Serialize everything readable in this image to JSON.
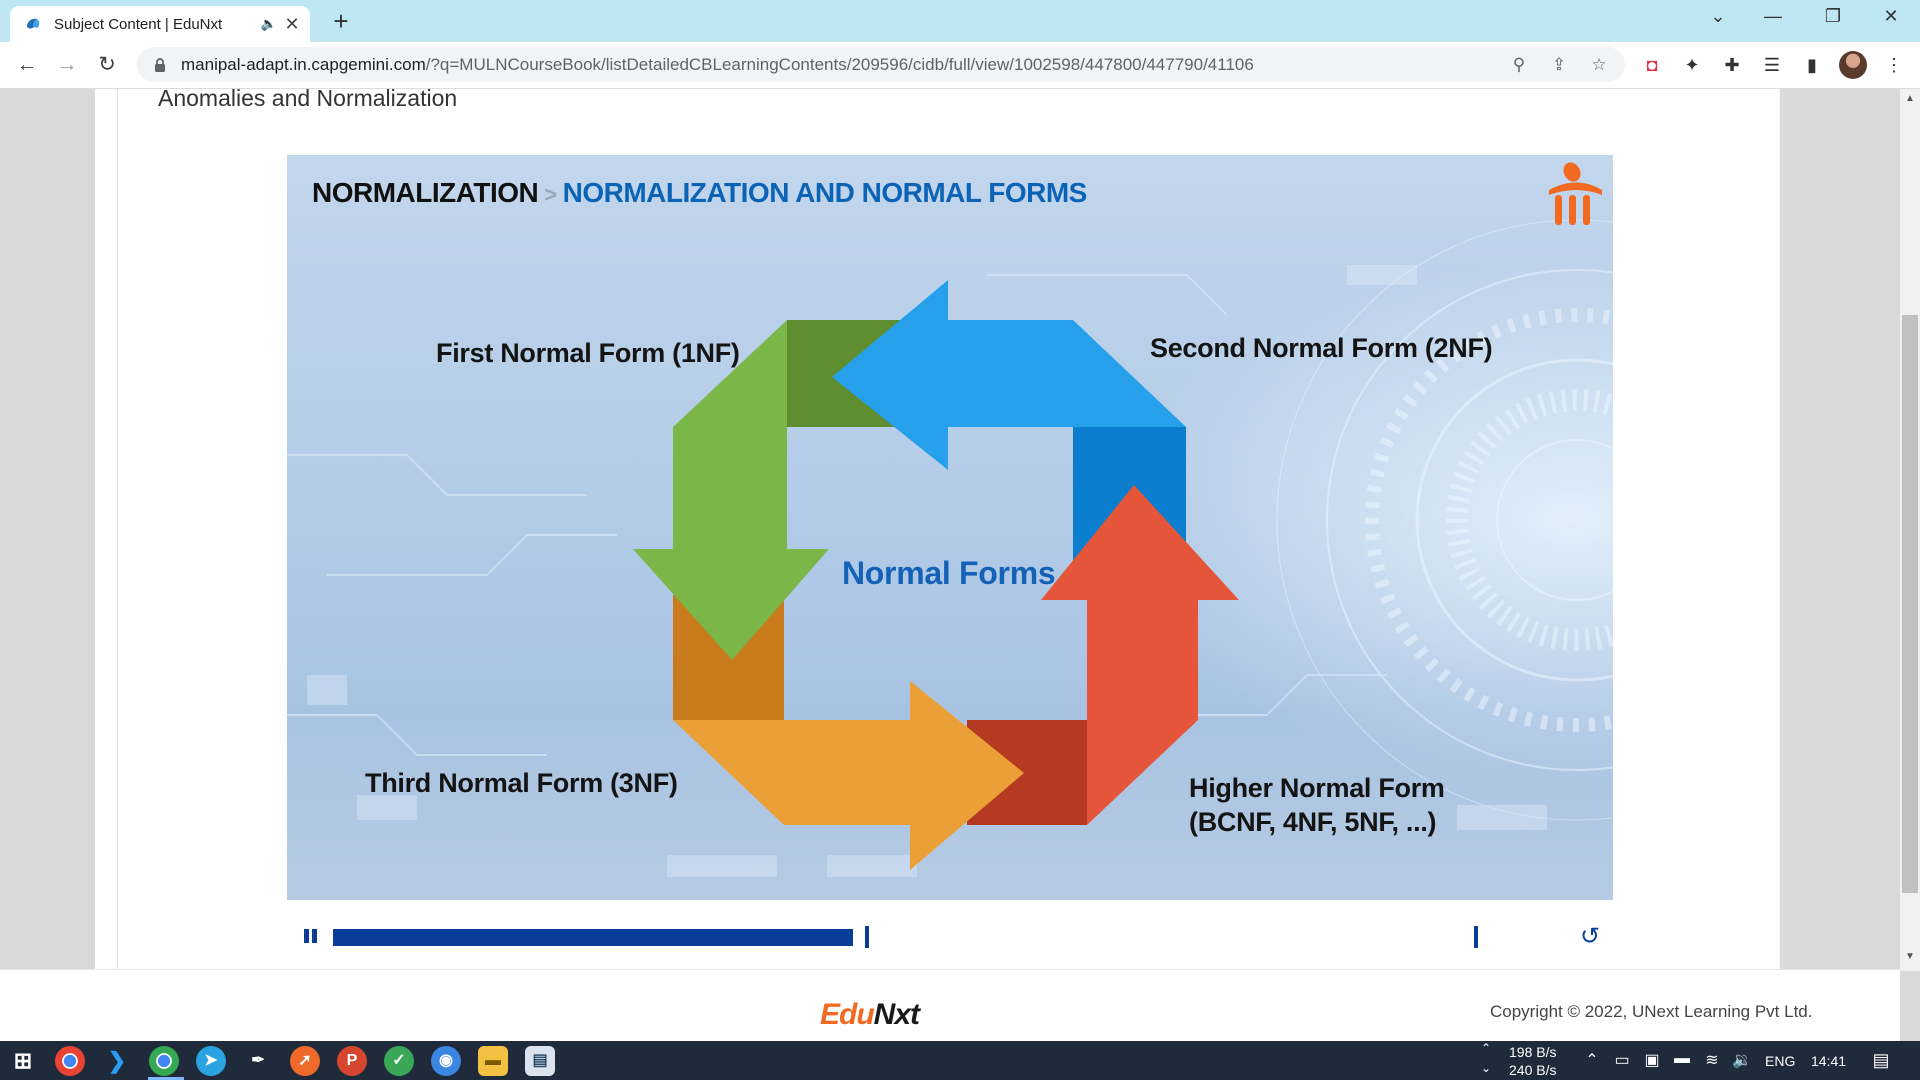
{
  "browser": {
    "tab": {
      "title": "Subject Content | EduNxt",
      "audio_icon": "speaker-icon",
      "close_glyph": "✕"
    },
    "new_tab_glyph": "+",
    "window_controls": {
      "tab_search": "⌄",
      "minimize": "—",
      "restore": "❐",
      "close": "✕"
    },
    "url": {
      "host": "manipal-adapt.in.capgemini.com",
      "path": "/?q=MULNCourseBook/listDetailedCBLearningContents/209596/cidb/full/view/1002598/447800/447790/41106"
    },
    "nav": {
      "back": "←",
      "forward": "→",
      "reload": "↻"
    },
    "omnibox_icons": {
      "zoom": "⚲",
      "share": "⇪",
      "bookmark": "☆"
    },
    "extension_icons": [
      "pocket-icon",
      "extension-badger-icon",
      "puzzle-icon",
      "media-queue-icon",
      "side-panel-icon",
      "profile-avatar"
    ],
    "menu_glyph": "⋮"
  },
  "page": {
    "heading": "Anomalies and Normalization"
  },
  "slide": {
    "breadcrumb_root": "NORMALIZATION",
    "breadcrumb_sep": ">",
    "breadcrumb_leaf": "NORMALIZATION AND NORMAL FORMS",
    "center_label": "Normal Forms",
    "label_1nf": "First Normal Form (1NF)",
    "label_2nf": "Second Normal Form (2NF)",
    "label_3nf": "Third Normal Form (3NF)",
    "label_higher_line1": "Higher Normal Form",
    "label_higher_line2": "(BCNF, 4NF, 5NF, ...)",
    "logo": "manipal-logo-icon",
    "colors": {
      "green": "#7ab648",
      "green_dark": "#5e8e2f",
      "blue": "#27a0eb",
      "blue_dark": "#0b7ed0",
      "red": "#e4553a",
      "red_dark": "#b63a21",
      "orange": "#eba037",
      "orange_dark": "#c97a1a"
    }
  },
  "player": {
    "pause_icon": "pause-icon",
    "replay_glyph": "↺",
    "progress": 0.383
  },
  "footer": {
    "logo_edu": "Edu",
    "logo_nxt": "Nxt",
    "copyright": "Copyright © 2022, UNext Learning Pvt Ltd."
  },
  "taskbar": {
    "apps": [
      "windows-start-icon",
      "chrome-icon",
      "vscode-icon",
      "chrome-profile-icon",
      "telegram-icon",
      "inkscape-icon",
      "postman-icon",
      "pdf-reader-icon",
      "shield-icon",
      "photos-icon",
      "file-explorer-icon",
      "media-icon"
    ],
    "net_up": "198 B/s",
    "net_down": "240 B/s",
    "language": "ENG",
    "time": "14:41"
  }
}
